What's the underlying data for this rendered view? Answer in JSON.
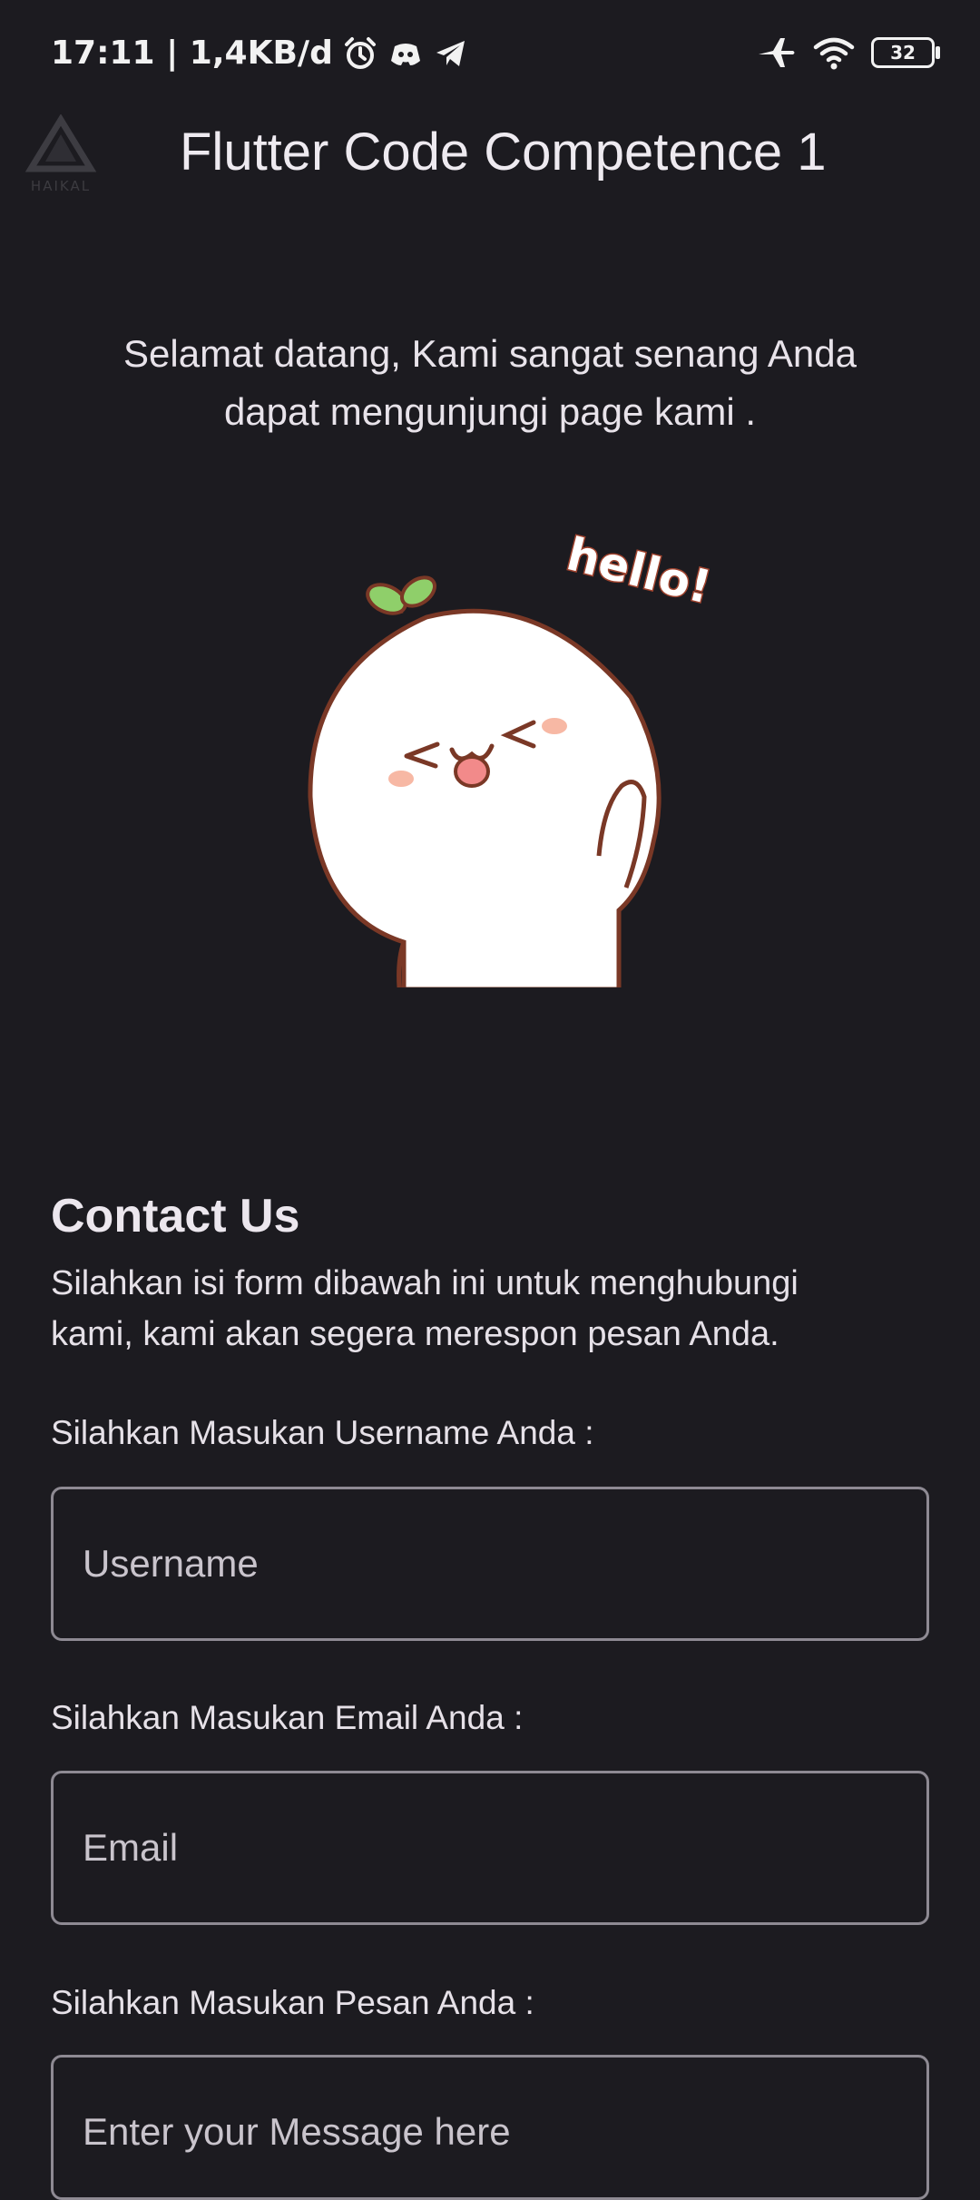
{
  "status_bar": {
    "time_speed": "17:11 | 1,4KB/d",
    "battery": "32",
    "icons": [
      "alarm-icon",
      "discord-icon",
      "telegram-icon",
      "airplane-icon",
      "wifi-icon",
      "battery-icon"
    ]
  },
  "app_bar": {
    "title": "Flutter Code Competence 1",
    "logo_text": "HAIKAL"
  },
  "welcome": {
    "line1": "Selamat datang, Kami sangat senang Anda",
    "line2": "dapat mengunjungi page kami ."
  },
  "sticker": {
    "caption": "hello!"
  },
  "contact": {
    "title": "Contact Us",
    "desc_line1": "Silahkan isi form dibawah ini untuk menghubungi",
    "desc_line2": "kami, kami akan segera merespon pesan Anda."
  },
  "form": {
    "username_label": "Silahkan Masukan Username Anda :",
    "username_placeholder": "Username",
    "email_label": "Silahkan Masukan Email Anda :",
    "email_placeholder": "Email",
    "message_label": "Silahkan Masukan Pesan Anda :",
    "message_placeholder": "Enter your Message here"
  },
  "colors": {
    "background": "#1c1b20",
    "text": "#e6e1e8",
    "outline": "#8e8a93"
  }
}
